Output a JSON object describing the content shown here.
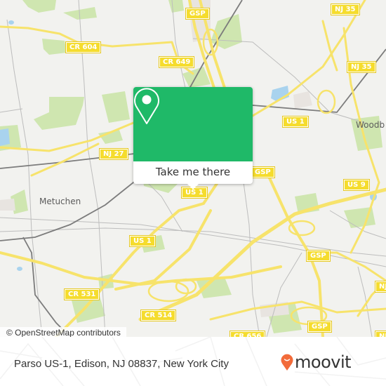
{
  "map": {
    "colors": {
      "land": "#f2f2ef",
      "park": "#cfe6b0",
      "water": "#a9d3ee",
      "highway": "#f7e36b",
      "minor_road": "#b8b8b8",
      "rail": "#7a7a7a",
      "shield": "#f5dc2d",
      "industrial": "#e8e4e0"
    },
    "road_shields": [
      {
        "id": "gsp-top",
        "label": "GSP"
      },
      {
        "id": "nj35-top",
        "label": "NJ 35"
      },
      {
        "id": "cr604",
        "label": "CR 604"
      },
      {
        "id": "cr649",
        "label": "CR 649"
      },
      {
        "id": "nj35-right",
        "label": "NJ 35"
      },
      {
        "id": "us1-north",
        "label": "US 1"
      },
      {
        "id": "nj27",
        "label": "NJ 27"
      },
      {
        "id": "gsp-mid",
        "label": "GSP"
      },
      {
        "id": "us1-center",
        "label": "US 1"
      },
      {
        "id": "us9",
        "label": "US 9"
      },
      {
        "id": "us1-west",
        "label": "US 1"
      },
      {
        "id": "gsp-east",
        "label": "GSP"
      },
      {
        "id": "cr531",
        "label": "CR 531"
      },
      {
        "id": "nj-right-1",
        "label": "NJ"
      },
      {
        "id": "cr514",
        "label": "CR 514"
      },
      {
        "id": "gsp-south",
        "label": "GSP"
      },
      {
        "id": "cr656",
        "label": "CR 656"
      },
      {
        "id": "nj-right-2",
        "label": "NJ"
      }
    ],
    "places": [
      {
        "id": "metuchen",
        "label": "Metuchen"
      },
      {
        "id": "woodbridge",
        "label": "Woodb"
      }
    ],
    "attribution": "© OpenStreetMap contributors"
  },
  "popup": {
    "icon": "location-pin-icon",
    "button_label": "Take me there",
    "color": "#1fb968"
  },
  "footer": {
    "address": "Parso US-1, Edison, NJ 08837, New York City",
    "brand": "moovit",
    "brand_icon": "moovit-pin-icon",
    "brand_color": "#f26b3a"
  }
}
